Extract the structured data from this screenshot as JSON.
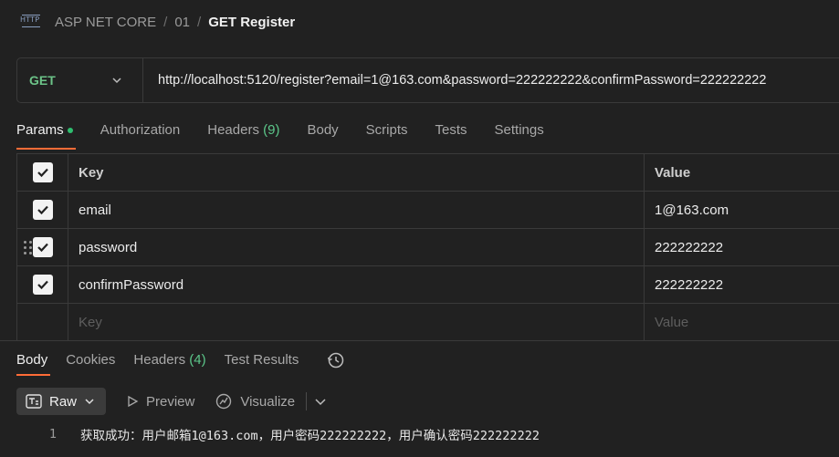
{
  "header": {
    "icon_text": "HTTP",
    "breadcrumb": [
      "ASP NET CORE",
      "01"
    ],
    "separator": "/",
    "title": "GET Register"
  },
  "request": {
    "method": "GET",
    "url": "http://localhost:5120/register?email=1@163.com&password=222222222&confirmPassword=222222222",
    "tabs": {
      "params": "Params",
      "authorization": "Authorization",
      "headers": "Headers",
      "headers_count": "(9)",
      "body": "Body",
      "scripts": "Scripts",
      "tests": "Tests",
      "settings": "Settings"
    },
    "params_table": {
      "key_header": "Key",
      "value_header": "Value",
      "rows": [
        {
          "key": "email",
          "value": "1@163.com",
          "checked": true
        },
        {
          "key": "password",
          "value": "222222222",
          "checked": true
        },
        {
          "key": "confirmPassword",
          "value": "222222222",
          "checked": true
        }
      ],
      "key_placeholder": "Key",
      "value_placeholder": "Value"
    }
  },
  "response": {
    "tabs": {
      "body": "Body",
      "cookies": "Cookies",
      "headers": "Headers",
      "headers_count": "(4)",
      "test_results": "Test Results"
    },
    "toolbar": {
      "raw": "Raw",
      "preview": "Preview",
      "visualize": "Visualize"
    },
    "body_lines": [
      {
        "number": "1",
        "text": "获取成功：用户邮箱1@163.com，用户密码222222222，用户确认密码222222222"
      }
    ]
  },
  "colors": {
    "background": "#212121",
    "method_get": "#6cc388",
    "active_tab_underline": "#ff6c37",
    "status_dot": "#2fbe6f"
  }
}
